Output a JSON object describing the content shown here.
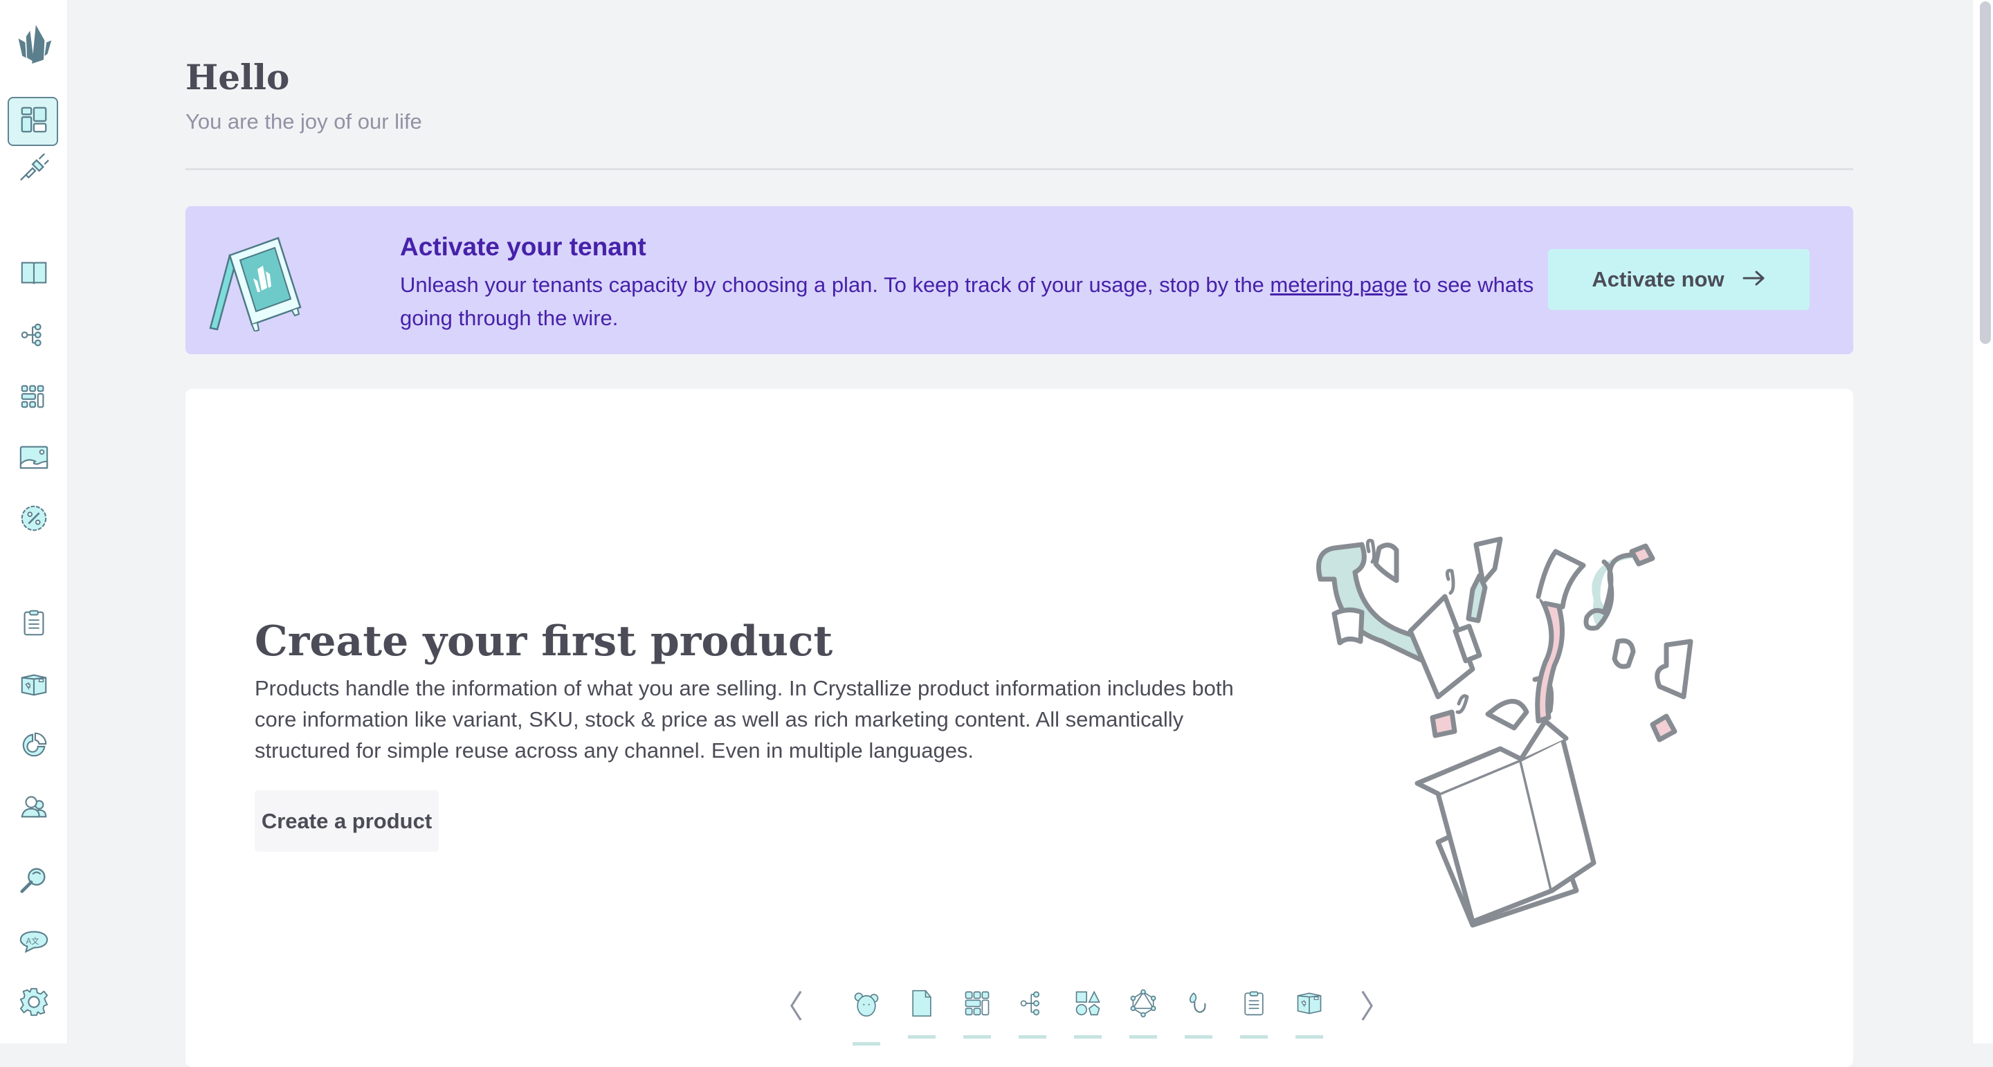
{
  "sidebar": {
    "logo": "crystallize-logo",
    "items": [
      {
        "icon": "dashboard-icon",
        "label": "Dashboard",
        "active": true
      },
      {
        "icon": "plug-icon",
        "label": "Integrations"
      },
      {
        "icon": "book-icon",
        "label": "Catalogue"
      },
      {
        "icon": "topics-icon",
        "label": "Topics"
      },
      {
        "icon": "grid-icon",
        "label": "Grids"
      },
      {
        "icon": "image-icon",
        "label": "Media"
      },
      {
        "icon": "discount-icon",
        "label": "Price lists"
      },
      {
        "icon": "clipboard-icon",
        "label": "Orders"
      },
      {
        "icon": "box-icon",
        "label": "Subscriptions"
      },
      {
        "icon": "pie-chart-icon",
        "label": "Analytics"
      },
      {
        "icon": "users-icon",
        "label": "Customers"
      },
      {
        "icon": "search-icon",
        "label": "Search"
      },
      {
        "icon": "translate-icon",
        "label": "Languages"
      },
      {
        "icon": "gear-icon",
        "label": "Settings"
      }
    ]
  },
  "header": {
    "title": "Hello",
    "subtitle": "You are the joy of our life"
  },
  "banner": {
    "title": "Activate your tenant",
    "text_before": "Unleash your tenants capacity by choosing a plan. To keep track of your usage, stop by the ",
    "link": "metering page",
    "text_after": " to see whats going through the wire.",
    "button_label": "Activate now",
    "button_icon": "arrow-right-icon",
    "colors": {
      "background": "#d9d4fb",
      "text": "#4621a9",
      "button": "#c6f4f4"
    }
  },
  "onboarding": {
    "title": "Create your first product",
    "description": "Products handle the information of what you are selling. In Crystallize product information includes both core information like variant, SKU, stock & price as well as rich marketing content. All semantically structured for simple reuse across any channel. Even in multiple languages.",
    "button_label": "Create a product",
    "carousel": {
      "prev_label": "〈",
      "next_label": "〉",
      "active_index": 0,
      "items": [
        {
          "icon": "mascot-icon"
        },
        {
          "icon": "document-icon"
        },
        {
          "icon": "grid-icon"
        },
        {
          "icon": "topics-icon"
        },
        {
          "icon": "shapes-icon"
        },
        {
          "icon": "graphql-icon"
        },
        {
          "icon": "hook-icon"
        },
        {
          "icon": "clipboard-icon"
        },
        {
          "icon": "box-icon"
        }
      ]
    }
  }
}
